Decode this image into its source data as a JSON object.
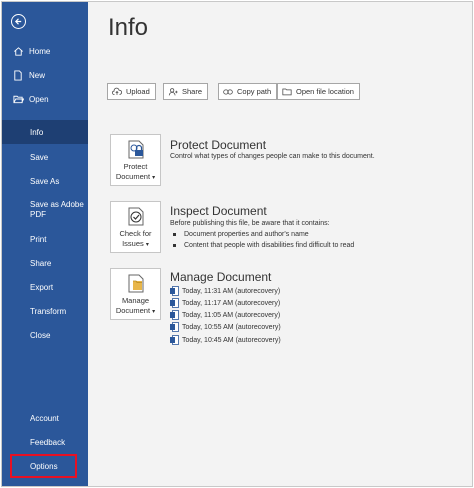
{
  "sidebar": {
    "back_label": "Back",
    "items": [
      {
        "label": "Home",
        "icon": "home-icon"
      },
      {
        "label": "New",
        "icon": "new-document-icon"
      },
      {
        "label": "Open",
        "icon": "folder-open-icon"
      },
      {
        "label": "Info",
        "selected": true
      },
      {
        "label": "Save"
      },
      {
        "label": "Save As"
      },
      {
        "label": "Save as Adobe PDF"
      },
      {
        "label": "Print"
      },
      {
        "label": "Share"
      },
      {
        "label": "Export"
      },
      {
        "label": "Transform"
      },
      {
        "label": "Close"
      },
      {
        "label": "Account"
      },
      {
        "label": "Feedback"
      },
      {
        "label": "Options",
        "highlighted": true
      }
    ]
  },
  "main": {
    "title": "Info",
    "toolbar": [
      {
        "label": "Upload",
        "icon": "cloud-upload-icon"
      },
      {
        "label": "Share",
        "icon": "person-share-icon"
      },
      {
        "label": "Copy path",
        "icon": "link-icon"
      },
      {
        "label": "Open file location",
        "icon": "folder-icon"
      }
    ],
    "protect": {
      "button_line1": "Protect",
      "button_line2": "Document",
      "title": "Protect Document",
      "description": "Control what types of changes people can make to this document."
    },
    "inspect": {
      "button_line1": "Check for",
      "button_line2": "Issues",
      "title": "Inspect Document",
      "description": "Before publishing this file, be aware that it contains:",
      "bullets": [
        "Document properties and author's name",
        "Content that people with disabilities find difficult to read"
      ]
    },
    "manage": {
      "button_line1": "Manage",
      "button_line2": "Document",
      "title": "Manage Document",
      "versions": [
        "Today, 11:31 AM (autorecovery)",
        "Today, 11:17 AM (autorecovery)",
        "Today, 11:05 AM (autorecovery)",
        "Today, 10:55 AM (autorecovery)",
        "Today, 10:45 AM (autorecovery)"
      ]
    }
  },
  "colors": {
    "sidebar_bg": "#2b579a",
    "sidebar_selected": "#1e3f73",
    "main_bg": "#f3f3f3",
    "highlight": "#e81123"
  }
}
